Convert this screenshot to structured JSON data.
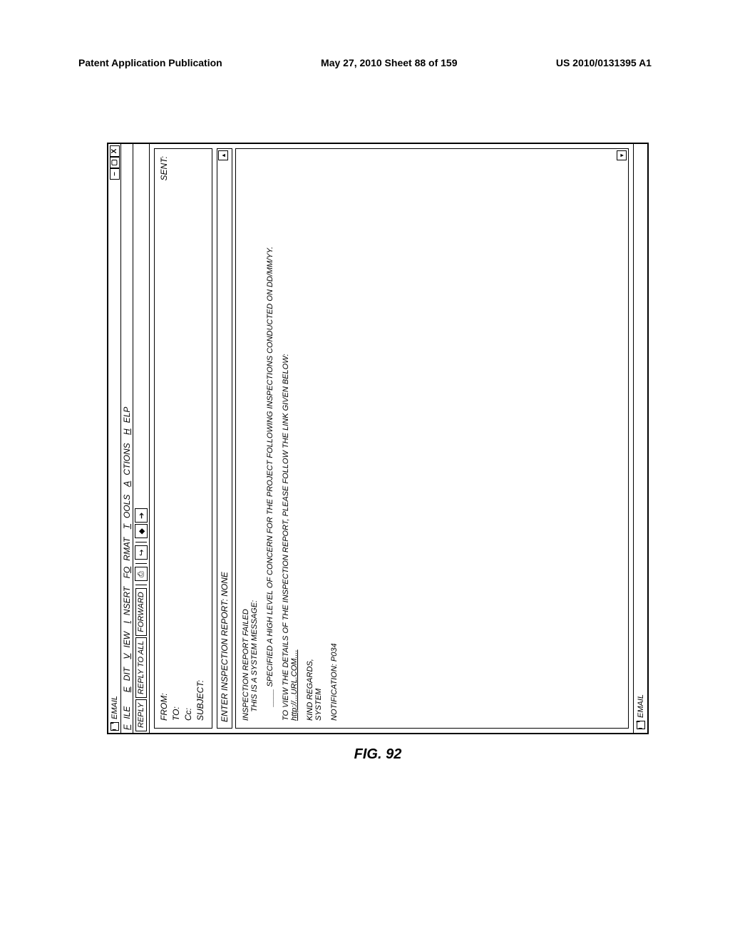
{
  "page_header": {
    "left": "Patent Application Publication",
    "center": "May 27, 2010  Sheet 88 of 159",
    "right": "US 2010/0131395 A1"
  },
  "titlebar": {
    "title": "EMAIL"
  },
  "window_controls": {
    "minimize": "–",
    "maximize": "▢",
    "close": "X"
  },
  "menubar": {
    "file": "FILE",
    "edit": "EDIT",
    "view": "VIEW",
    "insert": "INSERT",
    "format": "FORMAT",
    "tools": "TOOLS",
    "actions": "ACTIONS",
    "help": "HELP"
  },
  "toolbar": {
    "reply": "REPLY",
    "reply_all": "REPLY TO ALL",
    "forward": "FORWARD"
  },
  "header_fields": {
    "from_label": "FROM:",
    "to_label": "TO:",
    "cc_label": "Cc:",
    "subject_label": "SUBJECT:",
    "sent_label": "SENT:"
  },
  "subject_line": "ENTER INSPECTION REPORT:  NONE",
  "body": {
    "line1": "INSPECTION REPORT FAILED",
    "line2": "THIS IS A SYSTEM MESSAGE:",
    "line3": "____ SPECIFIED A HIGH LEVEL OF CONCERN FOR THE PROJECT FOLLOWING INSPECTIONS CONDUCTED ON DD/MM/YY.",
    "line4": "TO VIEW THE DETAILS OF THE INSPECTION REPORT, PLEASE FOLLOW THE LINK GIVEN BELOW:",
    "link": "http://...URL.COM....",
    "line5": "KIND REGARDS,",
    "line6": "SYSTEM",
    "line7": "NOTIFICATION: P034"
  },
  "statusbar": {
    "label": "EMAIL"
  },
  "figure_label": "FIG. 92"
}
